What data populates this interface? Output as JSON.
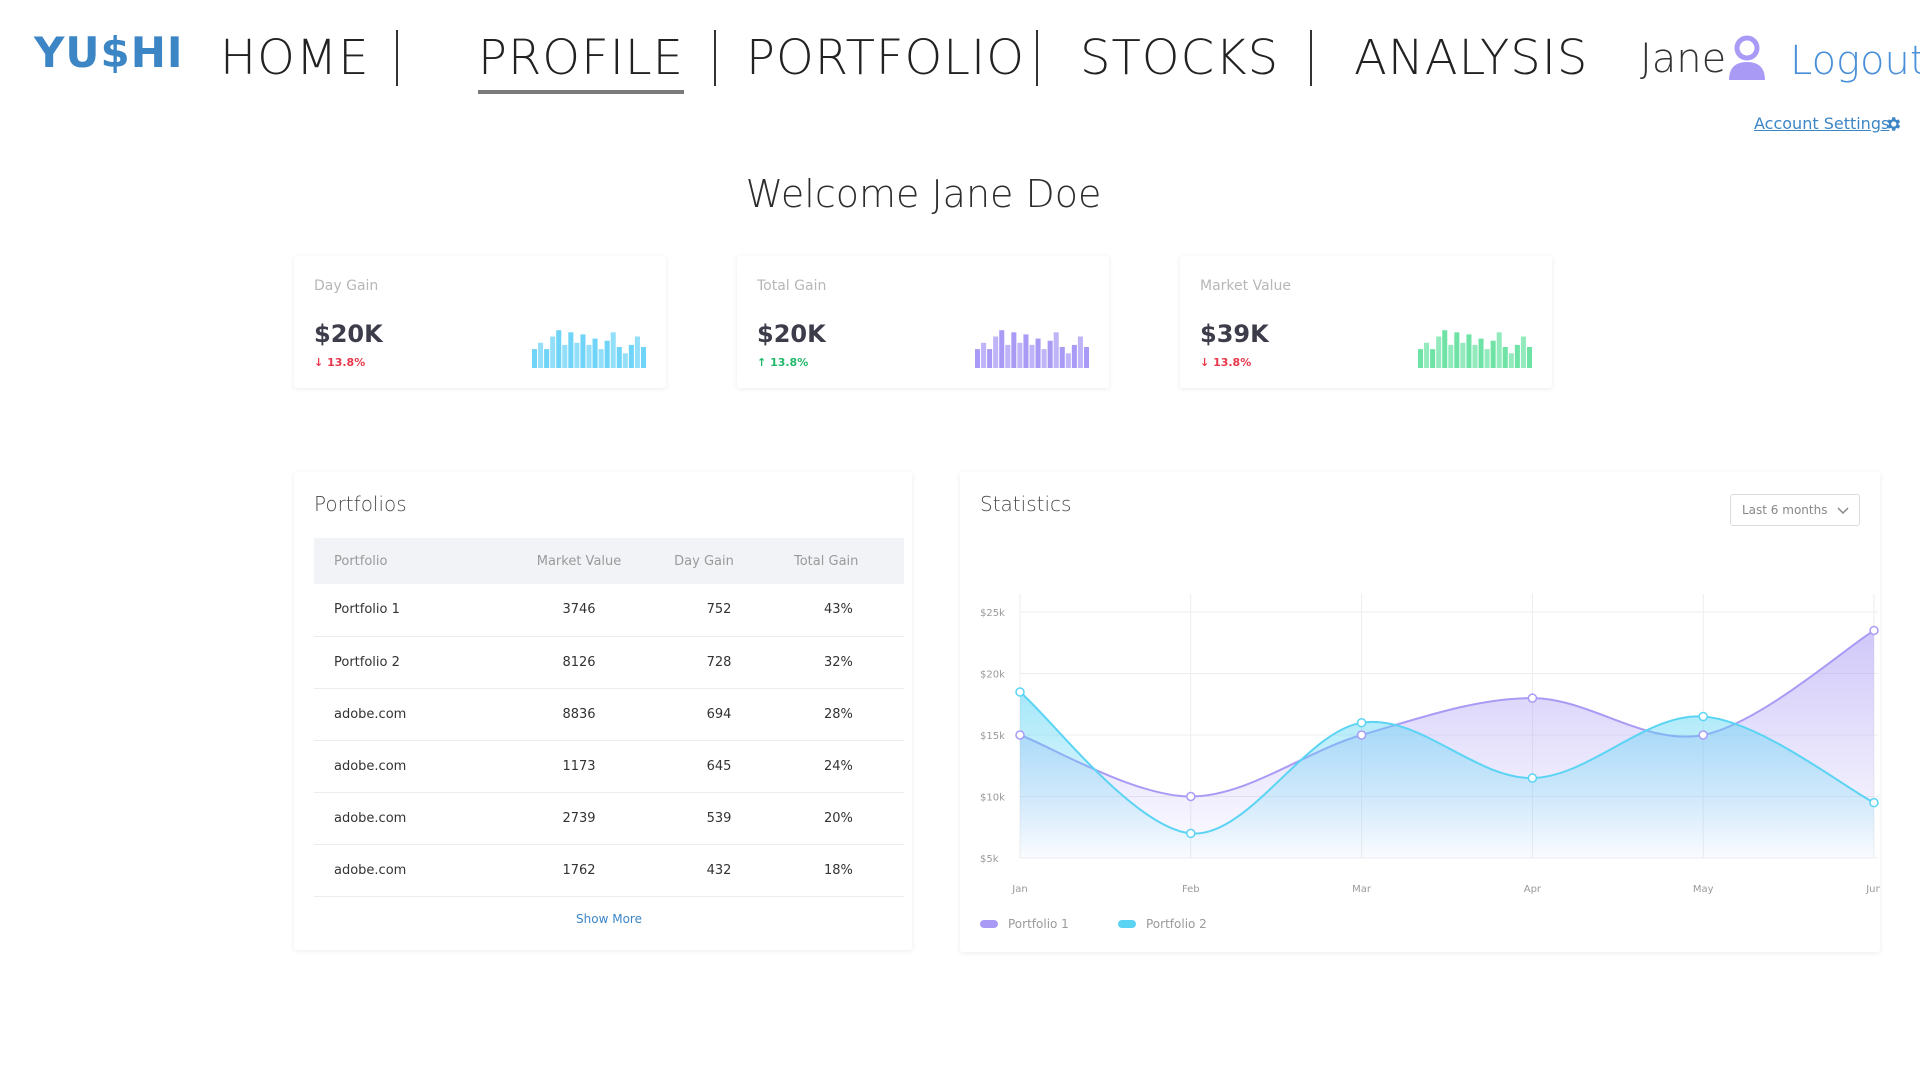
{
  "nav": {
    "logo": "YU$HI",
    "items": [
      "HOME",
      "PROFILE",
      "PORTFOLIO",
      "STOCKS",
      "ANALYSIS"
    ],
    "active": "PROFILE",
    "user_name": "Jane",
    "logout": "Logout",
    "account_settings": "Account Settings"
  },
  "welcome": "Welcome Jane Doe",
  "kpis": [
    {
      "title": "Day Gain",
      "value": "$20K",
      "change": "13.8%",
      "direction": "down",
      "color": "#6fd4f7",
      "bars": [
        0.45,
        0.6,
        0.45,
        0.75,
        0.9,
        0.55,
        0.85,
        0.6,
        0.8,
        0.55,
        0.7,
        0.45,
        0.65,
        0.85,
        0.5,
        0.35,
        0.55,
        0.75,
        0.5
      ]
    },
    {
      "title": "Total Gain",
      "value": "$20K",
      "change": "13.8%",
      "direction": "up",
      "color": "#a99bf5",
      "bars": [
        0.45,
        0.6,
        0.45,
        0.75,
        0.9,
        0.55,
        0.85,
        0.6,
        0.8,
        0.55,
        0.7,
        0.45,
        0.65,
        0.85,
        0.5,
        0.35,
        0.55,
        0.75,
        0.5
      ]
    },
    {
      "title": "Market Value",
      "value": "$39K",
      "change": "13.8%",
      "direction": "down",
      "color": "#6fe3a6",
      "bars": [
        0.45,
        0.6,
        0.45,
        0.75,
        0.9,
        0.55,
        0.85,
        0.6,
        0.8,
        0.55,
        0.7,
        0.45,
        0.65,
        0.85,
        0.5,
        0.35,
        0.55,
        0.75,
        0.5
      ]
    }
  ],
  "portfolios": {
    "title": "Portfolios",
    "columns": [
      "Portfolio",
      "Market Value",
      "Day Gain",
      "Total Gain"
    ],
    "rows": [
      [
        "Portfolio 1",
        "3746",
        "752",
        "43%"
      ],
      [
        "Portfolio 2",
        "8126",
        "728",
        "32%"
      ],
      [
        "adobe.com",
        "8836",
        "694",
        "28%"
      ],
      [
        "adobe.com",
        "1173",
        "645",
        "24%"
      ],
      [
        "adobe.com",
        "2739",
        "539",
        "20%"
      ],
      [
        "adobe.com",
        "1762",
        "432",
        "18%"
      ]
    ],
    "show_more": "Show More"
  },
  "statistics": {
    "title": "Statistics",
    "range_label": "Last 6 months"
  },
  "chart_data": {
    "type": "area",
    "categories": [
      "Jan",
      "Feb",
      "Mar",
      "Apr",
      "May",
      "Jun"
    ],
    "y_ticks": [
      "$5k",
      "$10k",
      "$15k",
      "$20k",
      "$25k"
    ],
    "ylim": [
      5000,
      25000
    ],
    "grid": true,
    "legend_position": "bottom-left",
    "series": [
      {
        "name": "Portfolio 1",
        "color": "#a99bf5",
        "values": [
          15000,
          10000,
          15000,
          18000,
          15000,
          23500
        ]
      },
      {
        "name": "Portfolio 2",
        "color": "#5bd4f4",
        "values": [
          18500,
          7000,
          16000,
          11500,
          16500,
          9500
        ]
      }
    ]
  },
  "colors": {
    "brand": "#3d86c6",
    "link": "#4a90d9",
    "down": "#e8374b",
    "up": "#22b86a"
  }
}
